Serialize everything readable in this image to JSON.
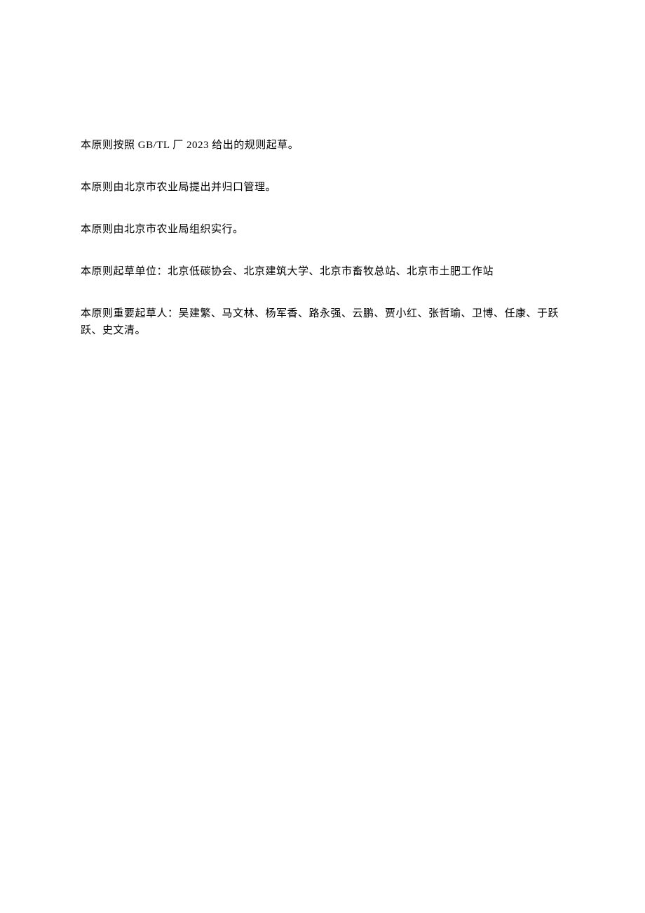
{
  "paragraphs": [
    "本原则按照 GB/TL 厂 2023 给出的规则起草。",
    "本原则由北京市农业局提出并归口管理。",
    "本原则由北京市农业局组织实行。",
    "本原则起草单位：北京低碳协会、北京建筑大学、北京市畜牧总站、北京市土肥工作站",
    "本原则重要起草人：吴建繁、马文林、杨军香、路永强、云鹏、贾小红、张哲瑜、卫博、任康、于跃跃、史文清。"
  ]
}
